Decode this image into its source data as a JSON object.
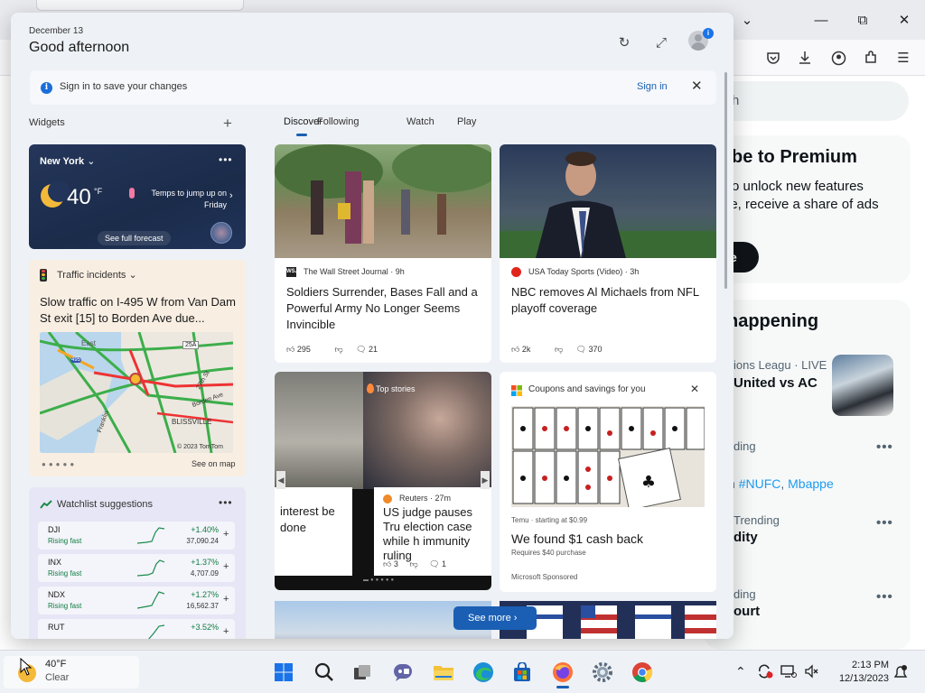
{
  "browser": {
    "search_placeholder": "h",
    "premium_title": "be to Premium",
    "premium_line1": "o unlock new features",
    "premium_line2": "le, receive a share of ads",
    "premium_button": "e",
    "happening_title": "happening",
    "trend1_meta": "ions Leagu · LIVE",
    "trend1_title": "United vs AC",
    "trend2_meta": "ding",
    "trend2_tags_prefix": "n",
    "trend2_tag1": "#NUFC",
    "trend2_tag2": "Mbappe",
    "trend3_meta": "Trending",
    "trend3_title": "dity",
    "trend4_meta": "ding",
    "trend4_title": "ourt",
    "more_dots": "•••"
  },
  "panel": {
    "date": "December 13",
    "greeting": "Good afternoon",
    "signin_text": "Sign in to save your changes",
    "signin_link": "Sign in",
    "widgets_label": "Widgets",
    "tabs": [
      "Discover",
      "Following",
      "Watch",
      "Play"
    ],
    "see_more": "See more"
  },
  "weather": {
    "city": "New York",
    "temp": "40",
    "unit": "°F",
    "note": "Temps to jump up on Friday",
    "forecast": "See full forecast"
  },
  "traffic": {
    "title": "Traffic incidents",
    "headline": "Slow traffic on I-495 W from Van Dam St exit [15] to Borden Ave due...",
    "map_labels": [
      "East",
      "25A",
      "495",
      "Blissville",
      "Borden Ave",
      "Franklin",
      "27th St"
    ],
    "copyright": "© 2023 TomTom",
    "see_on_map": "See on map"
  },
  "watchlist": {
    "title": "Watchlist suggestions",
    "stocks": [
      {
        "symbol": "DJI",
        "sub": "Rising fast",
        "pct": "+1.40%",
        "price": "37,090.24"
      },
      {
        "symbol": "INX",
        "sub": "Rising fast",
        "pct": "+1.37%",
        "price": "4,707.09"
      },
      {
        "symbol": "NDX",
        "sub": "Rising fast",
        "pct": "+1.27%",
        "price": "16,562.37"
      },
      {
        "symbol": "RUT",
        "sub": "",
        "pct": "+3.52%",
        "price": ""
      }
    ]
  },
  "news": [
    {
      "source": "The Wall Street Journal · 9h",
      "headline": "Soldiers Surrender, Bases Fall and a Powerful Army No Longer Seems Invincible",
      "likes": "295",
      "comments": "21"
    },
    {
      "source": "USA Today Sports (Video) · 3h",
      "headline": "NBC removes Al Michaels from NFL playoff coverage",
      "likes": "2k",
      "comments": "370"
    }
  ],
  "topstories": {
    "label": "Top stories",
    "left_text": "interest be done",
    "source": "Reuters · 27m",
    "headline": "US judge pauses Tru election case while h immunity ruling",
    "likes": "3",
    "comments": "1"
  },
  "coupon": {
    "title": "Coupons and savings for you",
    "meta": "Temu · starting at $0.99",
    "headline": "We found $1 cash back",
    "sub": "Requires $40 purchase",
    "sponsor": "Microsoft Sponsored"
  },
  "taskbar": {
    "temp": "40°F",
    "condition": "Clear",
    "time": "2:13 PM",
    "date": "12/13/2023"
  },
  "colors": {
    "accent": "#1a5fb4",
    "positive": "#0d7d3d",
    "weather_bg": "#24365a",
    "traffic_bg": "#f8eee2",
    "watchlist_bg": "#e7e6f6"
  }
}
